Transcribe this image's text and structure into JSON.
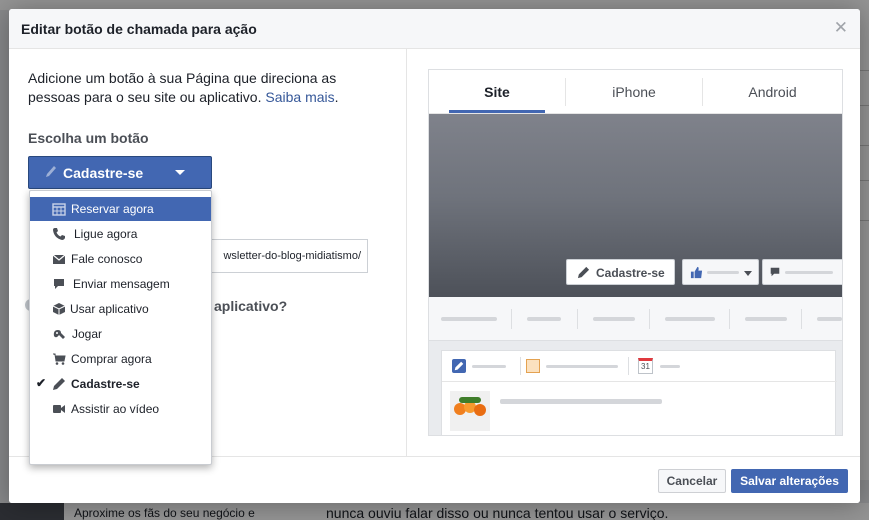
{
  "background": {
    "fan_text": "Aproxime os fãs do seu negócio e",
    "post_text": "nunca ouviu falar disso ou nunca tentou usar o serviço."
  },
  "modal": {
    "title": "Editar botão de chamada para ação",
    "close_icon": "close-icon",
    "description": "Adicione um botão à sua Página que direciona as pessoas para o seu site ou aplicativo.",
    "learn_more": "Saiba mais",
    "choose_label": "Escolha um botão",
    "selected_button": "Cadastre-se",
    "url_value": "wsletter-do-blog-midiatismo/",
    "question_partial": "aplicativo?",
    "menu": [
      {
        "label": "Reservar agora",
        "icon": "calendar-icon",
        "highlighted": true
      },
      {
        "label": "Ligue agora",
        "icon": "phone-icon"
      },
      {
        "label": "Fale conosco",
        "icon": "envelope-icon"
      },
      {
        "label": "Enviar mensagem",
        "icon": "chat-bubble-icon"
      },
      {
        "label": "Usar aplicativo",
        "icon": "cube-icon"
      },
      {
        "label": "Jogar",
        "icon": "gamepad-icon"
      },
      {
        "label": "Comprar agora",
        "icon": "cart-icon"
      },
      {
        "label": "Cadastre-se",
        "icon": "pencil-icon",
        "checked": true
      },
      {
        "label": "Assistir ao vídeo",
        "icon": "video-camera-icon"
      }
    ],
    "preview": {
      "tabs": [
        "Site",
        "iPhone",
        "Android"
      ],
      "active_tab": "Site",
      "cta_label": "Cadastre-se",
      "calendar_day": "31"
    },
    "footer": {
      "cancel": "Cancelar",
      "save": "Salvar alterações"
    }
  },
  "colors": {
    "accent": "#4267b2",
    "link": "#365899"
  }
}
